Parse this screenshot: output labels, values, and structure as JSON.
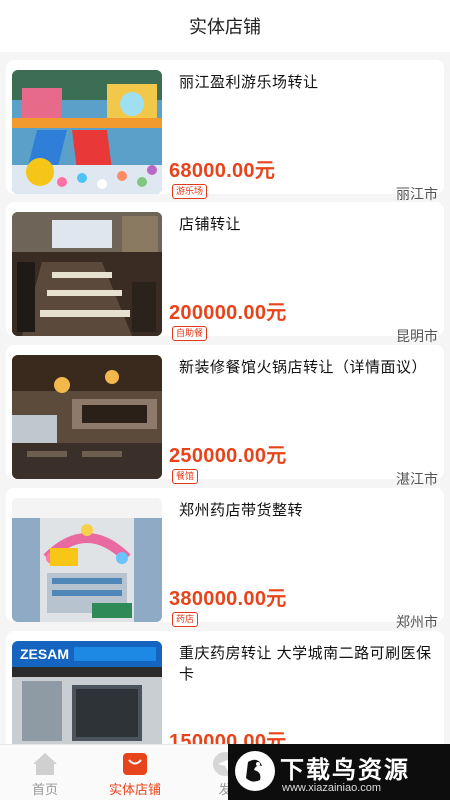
{
  "header": {
    "title": "实体店铺"
  },
  "listings": [
    {
      "title": "丽江盈利游乐场转让",
      "price": "68000.00元",
      "tag": "游乐场",
      "city": "丽江市",
      "image": "playground-photo"
    },
    {
      "title": "店铺转让",
      "price": "200000.00元",
      "tag": "自助餐",
      "city": "昆明市",
      "image": "buffet-restaurant-photo"
    },
    {
      "title": "新装修餐馆火锅店转让（详情面议）",
      "price": "250000.00元",
      "tag": "餐馆",
      "city": "湛江市",
      "image": "hotpot-restaurant-photo"
    },
    {
      "title": "郑州药店带货整转",
      "price": "380000.00元",
      "tag": "药店",
      "city": "郑州市",
      "image": "pharmacy-interior-photo"
    },
    {
      "title": "重庆药房转让 大学城南二路可刷医保卡",
      "price": "150000.00元",
      "tag": "",
      "city": "",
      "image": "pharmacy-storefront-photo"
    }
  ],
  "tabbar": {
    "home": "首页",
    "stores": "实体店铺",
    "publish": "发",
    "active_color": "#e8441c",
    "inactive_color": "#999999"
  },
  "watermark": {
    "brand": "下载鸟资源",
    "url": "www.xiazainiao.com"
  }
}
